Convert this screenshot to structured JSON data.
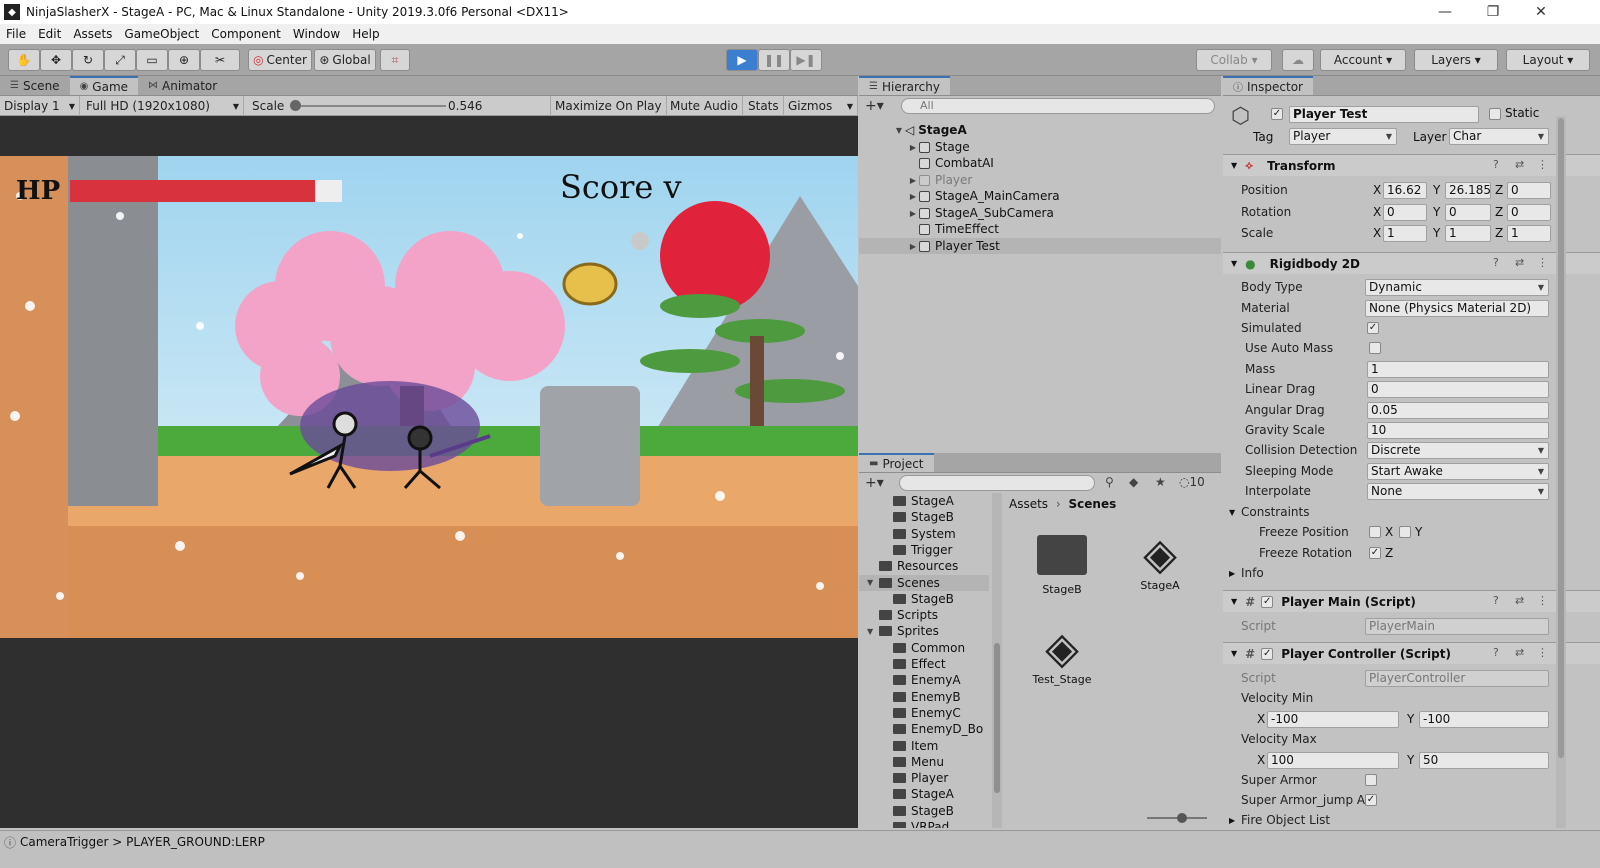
{
  "window": {
    "title": "NinjaSlasherX - StageA - PC, Mac & Linux Standalone - Unity 2019.3.0f6 Personal <DX11>"
  },
  "menu": [
    "File",
    "Edit",
    "Assets",
    "GameObject",
    "Component",
    "Window",
    "Help"
  ],
  "toolbar": {
    "pivot": "Center",
    "space": "Global",
    "collab": "Collab",
    "account": "Account",
    "layers": "Layers",
    "layout": "Layout"
  },
  "game_panel": {
    "tabs": [
      "Scene",
      "Game",
      "Animator"
    ],
    "display": "Display 1",
    "resolution": "Full HD (1920x1080)",
    "scale_label": "Scale",
    "scale_value": "0.546",
    "buttons": [
      "Maximize On Play",
      "Mute Audio",
      "Stats",
      "Gizmos"
    ],
    "hud": {
      "hp_label": "HP",
      "score_label": "Score v",
      "hp_fraction": 0.9
    }
  },
  "hierarchy": {
    "title": "Hierarchy",
    "search_placeholder": "All",
    "scene": "StageA",
    "items": [
      "Stage",
      "CombatAI",
      "Player",
      "StageA_MainCamera",
      "StageA_SubCamera",
      "TimeEffect",
      "Player Test"
    ]
  },
  "project": {
    "title": "Project",
    "visibility_count": "10",
    "tree": [
      "StageA",
      "StageB",
      "System",
      "Trigger",
      "Resources",
      "Scenes",
      "StageB",
      "Scripts",
      "Sprites",
      "Common",
      "Effect",
      "EnemyA",
      "EnemyB",
      "EnemyC",
      "EnemyD_Bo",
      "Item",
      "Menu",
      "Player",
      "StageA",
      "StageB",
      "VRPad"
    ],
    "breadcrumb": [
      "Assets",
      "Scenes"
    ],
    "assets": [
      "StageB",
      "StageA",
      "Test_Stage"
    ]
  },
  "inspector": {
    "title": "Inspector",
    "object_name": "Player Test",
    "static_label": "Static",
    "tag_label": "Tag",
    "tag": "Player",
    "layer_label": "Layer",
    "layer": "Char",
    "transform": {
      "title": "Transform",
      "position": {
        "label": "Position",
        "x": "16.62",
        "y": "26.185",
        "z": "0"
      },
      "rotation": {
        "label": "Rotation",
        "x": "0",
        "y": "0",
        "z": "0"
      },
      "scale": {
        "label": "Scale",
        "x": "1",
        "y": "1",
        "z": "1"
      }
    },
    "rigidbody": {
      "title": "Rigidbody 2D",
      "body_type": {
        "label": "Body Type",
        "value": "Dynamic"
      },
      "material": {
        "label": "Material",
        "value": "None (Physics Material 2D)"
      },
      "simulated": {
        "label": "Simulated"
      },
      "use_auto_mass": {
        "label": "Use Auto Mass"
      },
      "mass": {
        "label": "Mass",
        "value": "1"
      },
      "linear_drag": {
        "label": "Linear Drag",
        "value": "0"
      },
      "angular_drag": {
        "label": "Angular Drag",
        "value": "0.05"
      },
      "gravity_scale": {
        "label": "Gravity Scale",
        "value": "10"
      },
      "collision_detection": {
        "label": "Collision Detection",
        "value": "Discrete"
      },
      "sleeping_mode": {
        "label": "Sleeping Mode",
        "value": "Start Awake"
      },
      "interpolate": {
        "label": "Interpolate",
        "value": "None"
      },
      "constraints": "Constraints",
      "freeze_position": "Freeze Position",
      "freeze_rotation": "Freeze Rotation",
      "info": "Info"
    },
    "player_main": {
      "title": "Player Main (Script)",
      "script_label": "Script",
      "script": "PlayerMain"
    },
    "player_controller": {
      "title": "Player Controller (Script)",
      "script_label": "Script",
      "script": "PlayerController",
      "velocity_min": "Velocity Min",
      "vmin_x": "-100",
      "vmin_y": "-100",
      "velocity_max": "Velocity Max",
      "vmax_x": "100",
      "vmax_y": "50",
      "super_armor": "Super Armor",
      "super_armor_jump": "Super Armor_jump At",
      "fire_object_list": "Fire Object List"
    }
  },
  "status": {
    "message": "CameraTrigger > PLAYER_GROUND:LERP"
  }
}
